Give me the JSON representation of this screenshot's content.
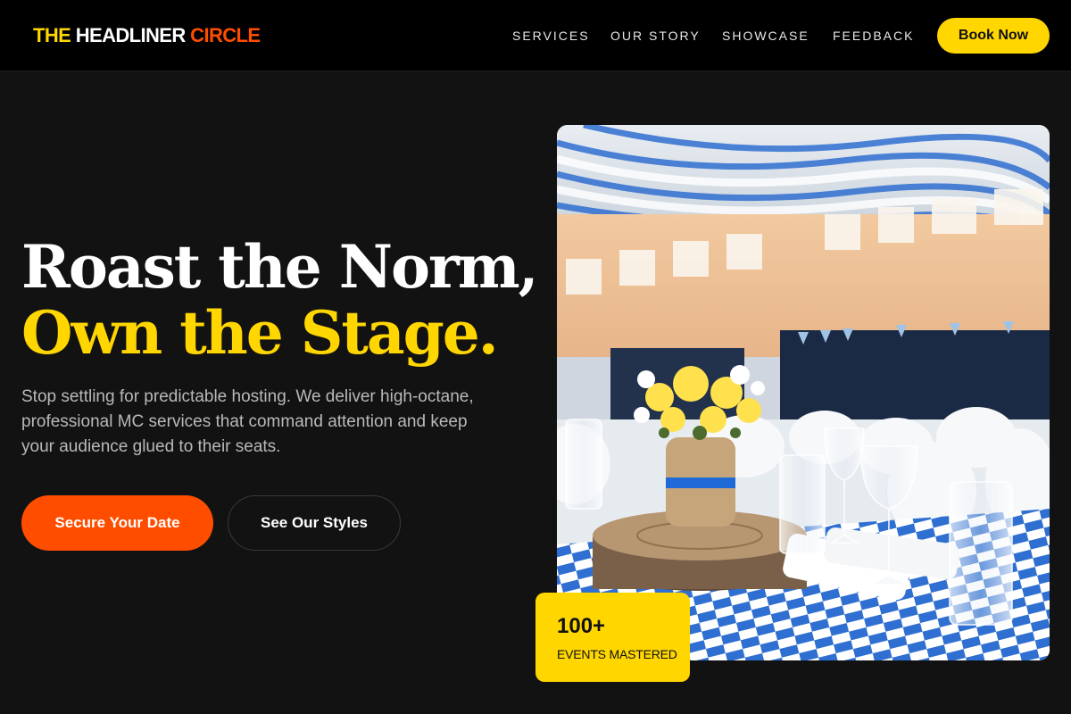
{
  "header": {
    "logo": {
      "word1": "THE",
      "word2": "HEADLINER",
      "word3": "CIRCLE"
    },
    "nav": [
      "SERVICES",
      "OUR STORY",
      "SHOWCASE",
      "FEEDBACK"
    ],
    "book_label": "Book Now"
  },
  "hero": {
    "headline_line1": "Roast the Norm,",
    "headline_line2": "Own the Stage.",
    "subtext": "Stop settling for predictable hosting. We deliver high-octane, professional MC services that command attention and keep your audience glued to their seats.",
    "cta_primary": "Secure Your Date",
    "cta_secondary": "See Our Styles",
    "image_icon": "banquet-hall-photo",
    "stat": {
      "number": "100+",
      "label": "EVENTS MASTERED"
    }
  },
  "colors": {
    "accent_yellow": "#FFD600",
    "accent_orange": "#FF4D00",
    "background": "#121212",
    "header_bg": "#000000"
  }
}
